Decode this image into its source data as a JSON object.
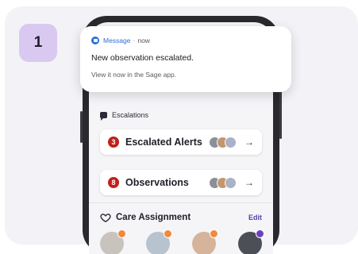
{
  "step": {
    "number": "1"
  },
  "notification": {
    "app_name": "Message",
    "time": "now",
    "title": "New observation escalated.",
    "body": "View it now in the Sage app."
  },
  "escalations": {
    "header": "Escalations",
    "rows": [
      {
        "count": "3",
        "label": "Escalated Alerts",
        "avatar_colors": [
          "#8c8f97",
          "#c4966f",
          "#a9b2c7"
        ]
      },
      {
        "count": "8",
        "label": "Observations",
        "avatar_colors": [
          "#8c8f97",
          "#c4966f",
          "#a9b2c7"
        ]
      }
    ]
  },
  "care_assignment": {
    "title": "Care Assignment",
    "edit_label": "Edit",
    "people": [
      {
        "tag_color": "#f08a3c",
        "photo_color": "#c9c3bd"
      },
      {
        "tag_color": "#f08a3c",
        "photo_color": "#b7c3cf"
      },
      {
        "tag_color": "#f08a3c",
        "photo_color": "#d5b49b"
      },
      {
        "tag_color": "#6b3fc2",
        "photo_color": "#4c4f57"
      }
    ]
  },
  "colors": {
    "accent": "#5a3ea8",
    "alert_red": "#c0201c",
    "badge_bg": "#d9c9f1",
    "message_blue": "#2c6fd8"
  }
}
